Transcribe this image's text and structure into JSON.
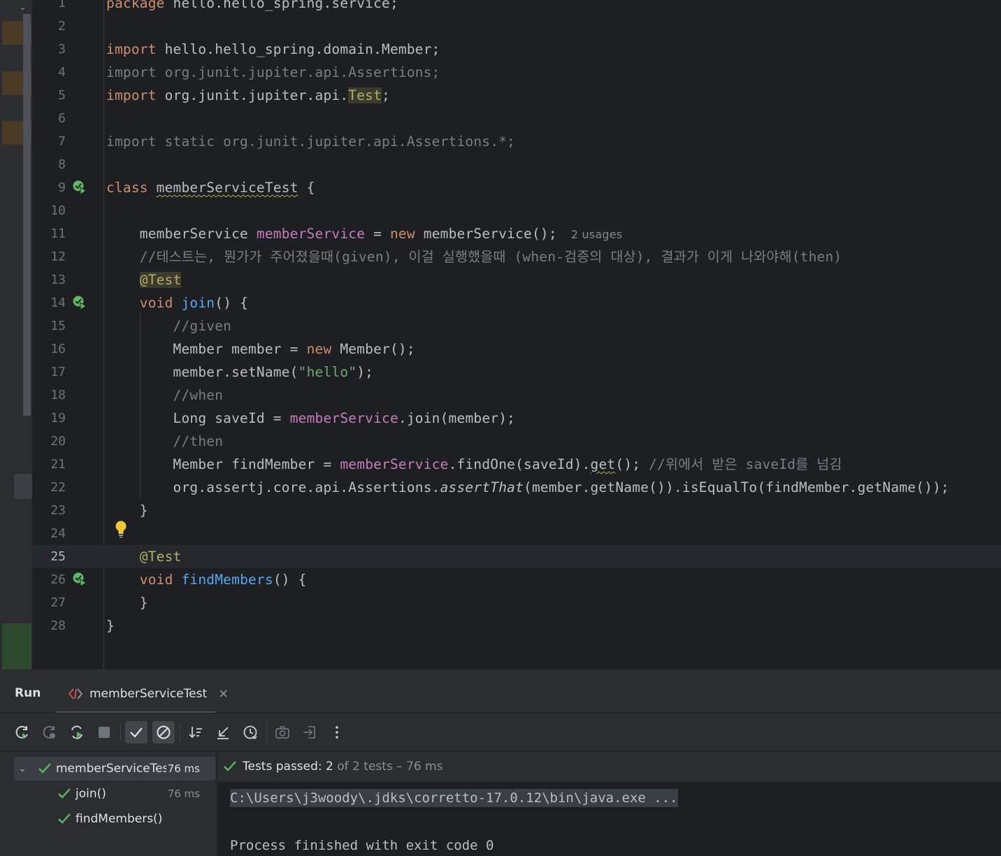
{
  "editor": {
    "lines": [
      {
        "n": "1",
        "html": "<span class='kw'>package</span> hello.hello_spring.service;"
      },
      {
        "n": "2",
        "html": ""
      },
      {
        "n": "3",
        "html": "<span class='kw'>import</span> hello.hello_spring.domain.Member;"
      },
      {
        "n": "4",
        "html": "<span class='dim'>import org.junit.jupiter.api.Assertions;</span>"
      },
      {
        "n": "5",
        "html": "<span class='kw'>import</span> org.junit.jupiter.api.<span class='hl'>Test</span>;"
      },
      {
        "n": "6",
        "html": ""
      },
      {
        "n": "7",
        "html": "<span class='dim'>import static org.junit.jupiter.api.Assertions.*;</span>"
      },
      {
        "n": "8",
        "html": ""
      },
      {
        "n": "9",
        "html": "<span class='kw'>class</span> <span class='wavy'>memberServiceTest</span> {"
      },
      {
        "n": "10",
        "html": ""
      },
      {
        "n": "11",
        "html": "    memberService <span class='field'>memberService</span> = <span class='kw'>new</span> memberService();<span class='hint'>2 usages</span>"
      },
      {
        "n": "12",
        "html": "    <span class='cmt'>//테스트는, 뭔가가 주어졌을때(given), 이걸 실행했을때 (when-검증의 대상), 결과가 이게 나와야해(then)</span>"
      },
      {
        "n": "13",
        "html": "    <span class='hl'>@Test</span>"
      },
      {
        "n": "14",
        "html": "    <span class='kw'>void</span> <span class='fn'>join</span>() {"
      },
      {
        "n": "15",
        "html": "        <span class='cmt'>//given</span>"
      },
      {
        "n": "16",
        "html": "        Member member = <span class='kw'>new</span> Member();"
      },
      {
        "n": "17",
        "html": "        member.setName(<span class='str'>\"hello\"</span>);"
      },
      {
        "n": "18",
        "html": "        <span class='cmt'>//when</span>"
      },
      {
        "n": "19",
        "html": "        Long saveId = <span class='field'>memberService</span>.join(member);"
      },
      {
        "n": "20",
        "html": "        <span class='cmt'>//then</span>"
      },
      {
        "n": "21",
        "html": "        Member findMember = <span class='field'>memberService</span>.findOne(saveId).<span class='wavy'>get</span>(); <span class='cmt'>//위에서 받은 saveId를 넘김</span>"
      },
      {
        "n": "22",
        "html": "        org.assertj.core.api.Assertions.<span class='it'>assertThat</span>(member.getName()).isEqualTo(findMember.getName());"
      },
      {
        "n": "23",
        "html": "    }"
      },
      {
        "n": "24",
        "html": ""
      },
      {
        "n": "25",
        "html": "    <span class='ann'>@Test</span>"
      },
      {
        "n": "26",
        "html": "    <span class='kw'>void</span> <span class='fn'>findMembers</span>() {"
      },
      {
        "n": "27",
        "html": "    }"
      },
      {
        "n": "28",
        "html": "}"
      }
    ],
    "current_line": "25",
    "run_gutter_lines": [
      "9",
      "14",
      "26"
    ]
  },
  "run_panel": {
    "title": "Run",
    "tab_label": "memberServiceTest",
    "tree": [
      {
        "label": "memberServiceTest",
        "time": "76 ms",
        "selected": true,
        "expanded": true
      },
      {
        "label": "join()",
        "time": "76 ms"
      },
      {
        "label": "findMembers()",
        "time": ""
      }
    ],
    "status": {
      "prefix": "Tests passed: ",
      "count": "2",
      "suffix": " of 2 tests – 76 ms"
    },
    "console": {
      "path_line": "C:\\Users\\j3woody\\.jdks\\corretto-17.0.12\\bin\\java.exe ...",
      "exit_line": "Process finished with exit code 0"
    }
  },
  "colors": {
    "passed": "#5fb865",
    "keyword": "#cf8e6d",
    "function": "#56a8f5",
    "field": "#c77dbb",
    "string": "#6aab73",
    "annotation": "#b3ae60"
  }
}
